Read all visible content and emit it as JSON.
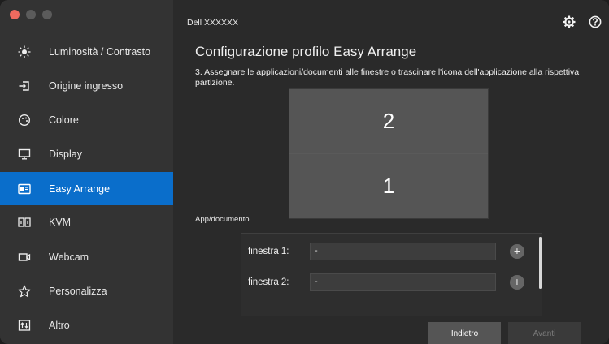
{
  "app": {
    "monitor_name": "Dell XXXXXX"
  },
  "sidebar": {
    "items": [
      {
        "label": "Luminosità / Contrasto",
        "icon": "brightness-icon"
      },
      {
        "label": "Origine ingresso",
        "icon": "input-source-icon"
      },
      {
        "label": "Colore",
        "icon": "color-icon"
      },
      {
        "label": "Display",
        "icon": "display-icon"
      },
      {
        "label": "Easy Arrange",
        "icon": "easy-arrange-icon",
        "active": true
      },
      {
        "label": "KVM",
        "icon": "kvm-icon"
      },
      {
        "label": "Webcam",
        "icon": "webcam-icon"
      },
      {
        "label": "Personalizza",
        "icon": "star-icon"
      },
      {
        "label": "Altro",
        "icon": "other-icon"
      }
    ]
  },
  "main": {
    "title": "Configurazione profilo Easy Arrange",
    "instructions": "3. Assegnare le applicazioni/documenti alle finestre o trascinare l'icona dell'applicazione alla rispettiva partizione.",
    "partitions": [
      "2",
      "1"
    ],
    "section_label": "App/documento",
    "windows": [
      {
        "label": "finestra 1:",
        "value": "-"
      },
      {
        "label": "finestra 2:",
        "value": "-"
      }
    ],
    "buttons": {
      "back": "Indietro",
      "next": "Avanti"
    }
  },
  "colors": {
    "accent": "#0a6ecb",
    "sidebar_bg": "#333333",
    "main_bg": "#2a2a2a"
  }
}
